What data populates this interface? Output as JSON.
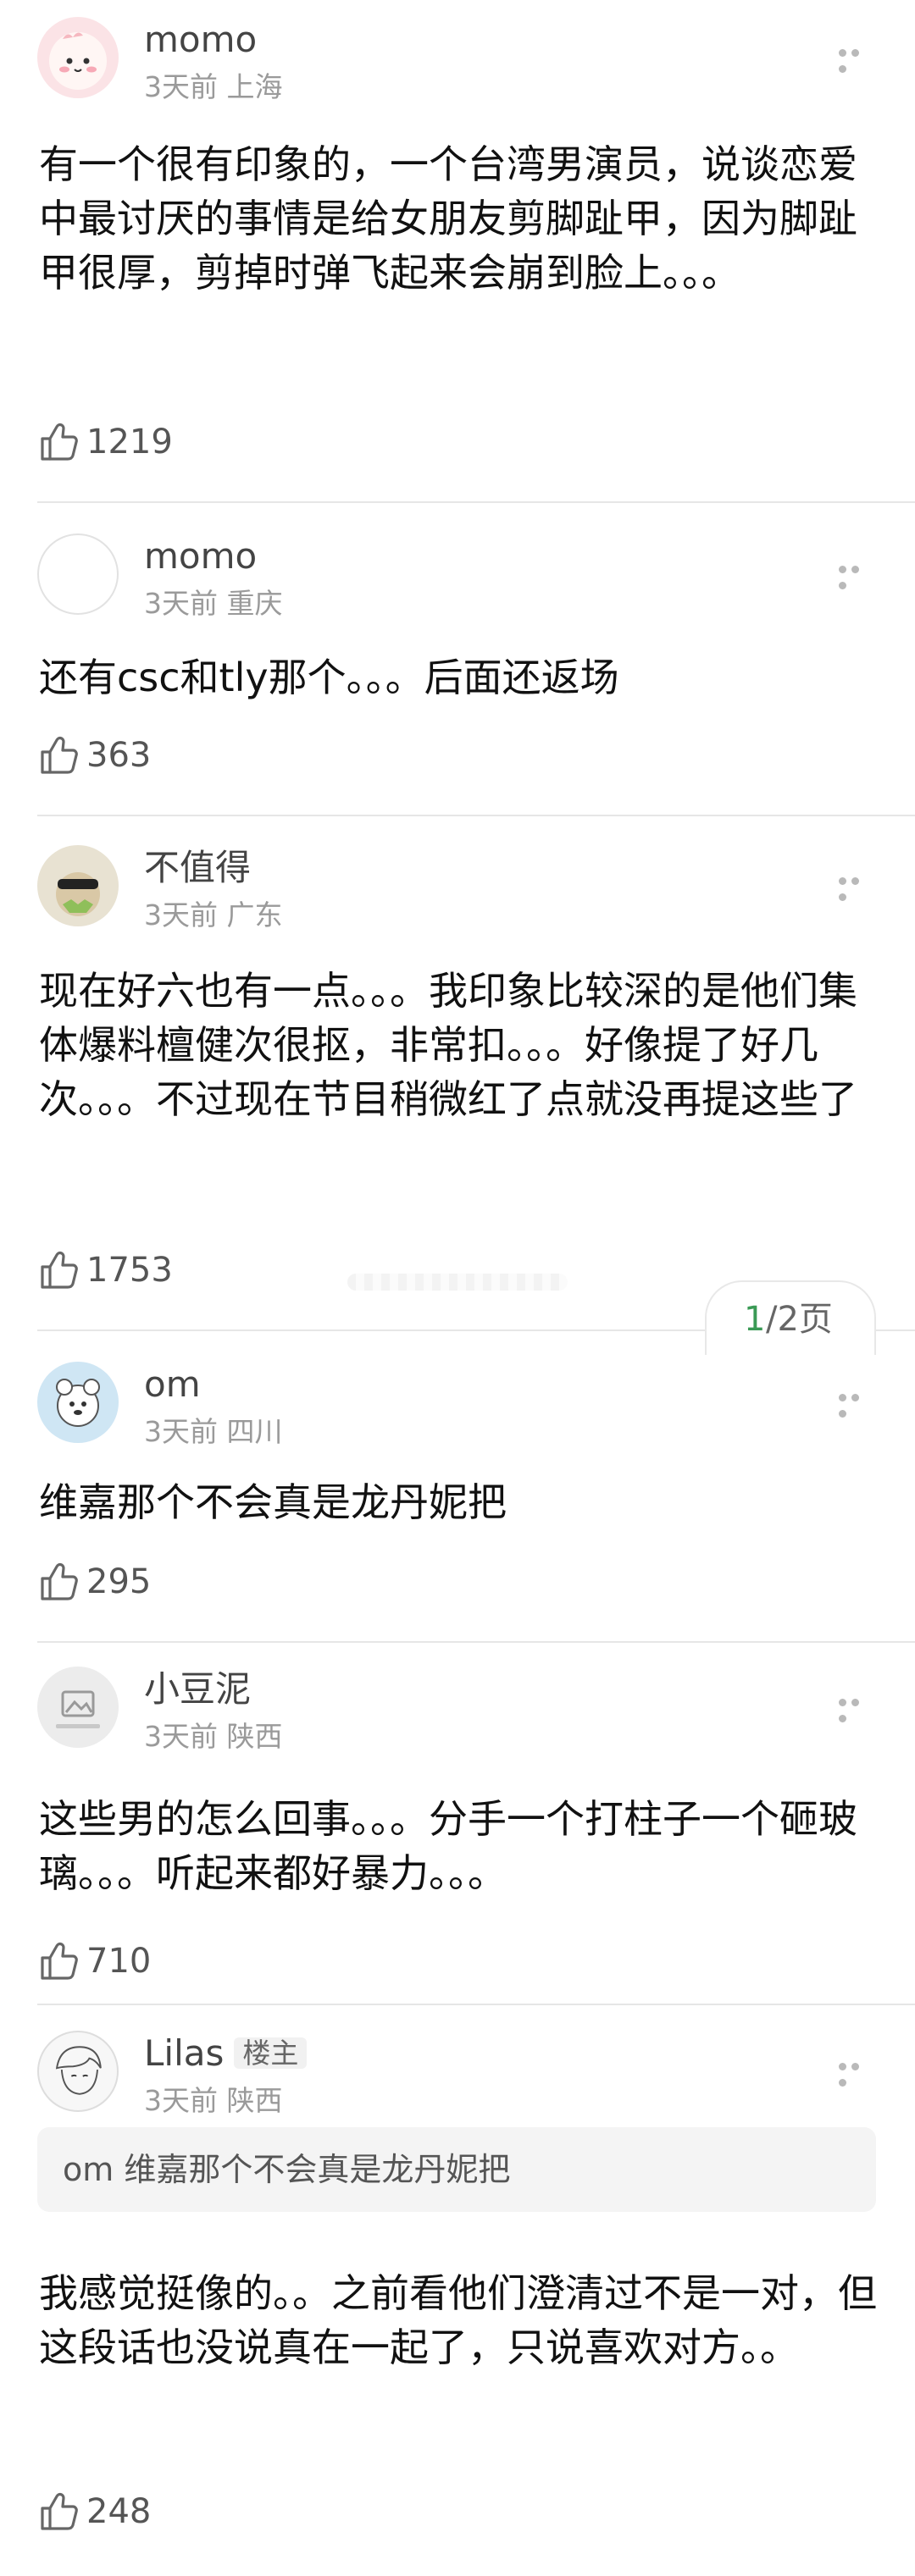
{
  "comments": [
    {
      "username": "momo",
      "meta": "3天前 上海",
      "text": "有一个很有印象的，一个台湾男演员，说谈恋爱中最讨厌的事情是给女朋友剪脚趾甲，因为脚趾甲很厚，剪掉时弹飞起来会崩到脸上。。。",
      "likes": "1219"
    },
    {
      "username": "momo",
      "meta": "3天前 重庆",
      "text": "还有csc和tly那个。。。后面还返场",
      "likes": "363"
    },
    {
      "username": "不值得",
      "meta": "3天前 广东",
      "text": "现在好六也有一点。。。我印象比较深的是他们集体爆料檀健次很抠，非常扣。。。好像提了好几次。。。不过现在节目稍微红了点就没再提这些了",
      "likes": "1753"
    },
    {
      "username": "om",
      "meta": "3天前 四川",
      "text": "维嘉那个不会真是龙丹妮把",
      "likes": "295"
    },
    {
      "username": "小豆泥",
      "meta": "3天前 陕西",
      "text": "这些男的怎么回事。。。分手一个打柱子一个砸玻璃。。。听起来都好暴力。。。",
      "likes": "710"
    },
    {
      "username": "Lilas",
      "badge": "楼主",
      "meta": "3天前 陕西",
      "quote": "om 维嘉那个不会真是龙丹妮把",
      "text": "我感觉挺像的。。之前看他们澄清过不是一对，但这段话也没说真在一起了，只说喜欢对方。。",
      "likes": "248"
    }
  ],
  "pager": {
    "current": "1",
    "rest": "/2页"
  }
}
